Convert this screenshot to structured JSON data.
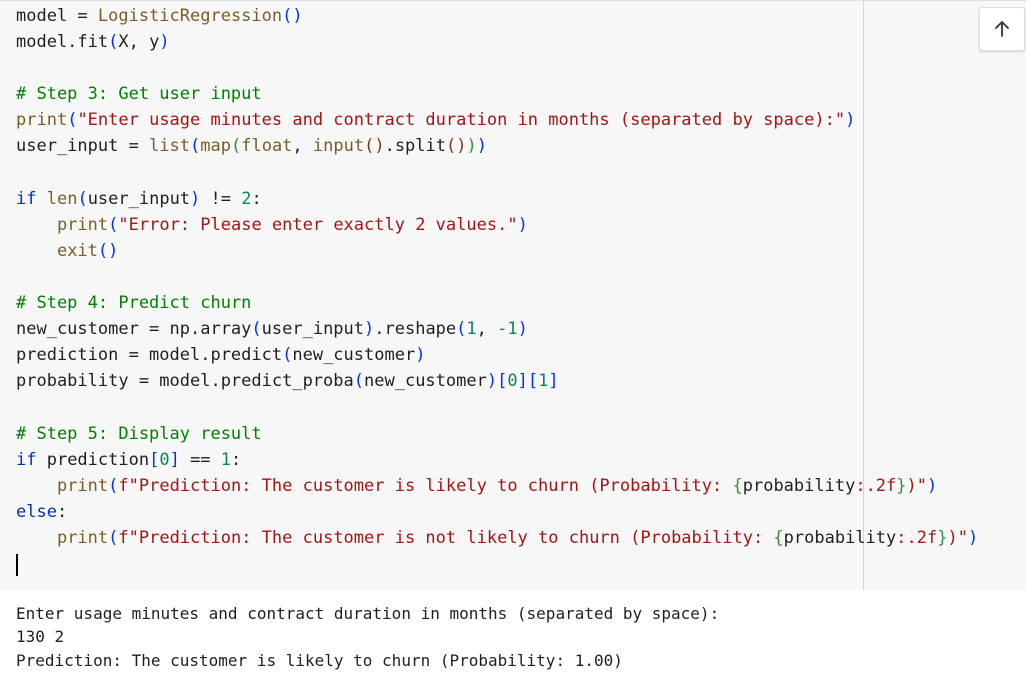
{
  "code_cell": {
    "lines": [
      "model = LogisticRegression()",
      "model.fit(X, y)",
      "",
      "# Step 3: Get user input",
      "print(\"Enter usage minutes and contract duration in months (separated by space):\")",
      "user_input = list(map(float, input().split()))",
      "",
      "if len(user_input) != 2:",
      "    print(\"Error: Please enter exactly 2 values.\")",
      "    exit()",
      "",
      "# Step 4: Predict churn",
      "new_customer = np.array(user_input).reshape(1, -1)",
      "prediction = model.predict(new_customer)",
      "probability = model.predict_proba(new_customer)[0][1]",
      "",
      "# Step 5: Display result",
      "if prediction[0] == 1:",
      "    print(f\"Prediction: The customer is likely to churn (Probability: {probability:.2f})\")",
      "else:",
      "    print(f\"Prediction: The customer is not likely to churn (Probability: {probability:.2f})\")",
      ""
    ]
  },
  "scroll_button": {
    "icon": "arrow-up-icon"
  },
  "output": {
    "lines": [
      "Enter usage minutes and contract duration in months (separated by space):",
      "130 2",
      "Prediction: The customer is likely to churn (Probability: 1.00)"
    ]
  },
  "colors": {
    "editor_bg": "#f7f7f7",
    "comment": "#008000",
    "string": "#a31515",
    "number": "#098658",
    "keyword": "#0033b3"
  }
}
